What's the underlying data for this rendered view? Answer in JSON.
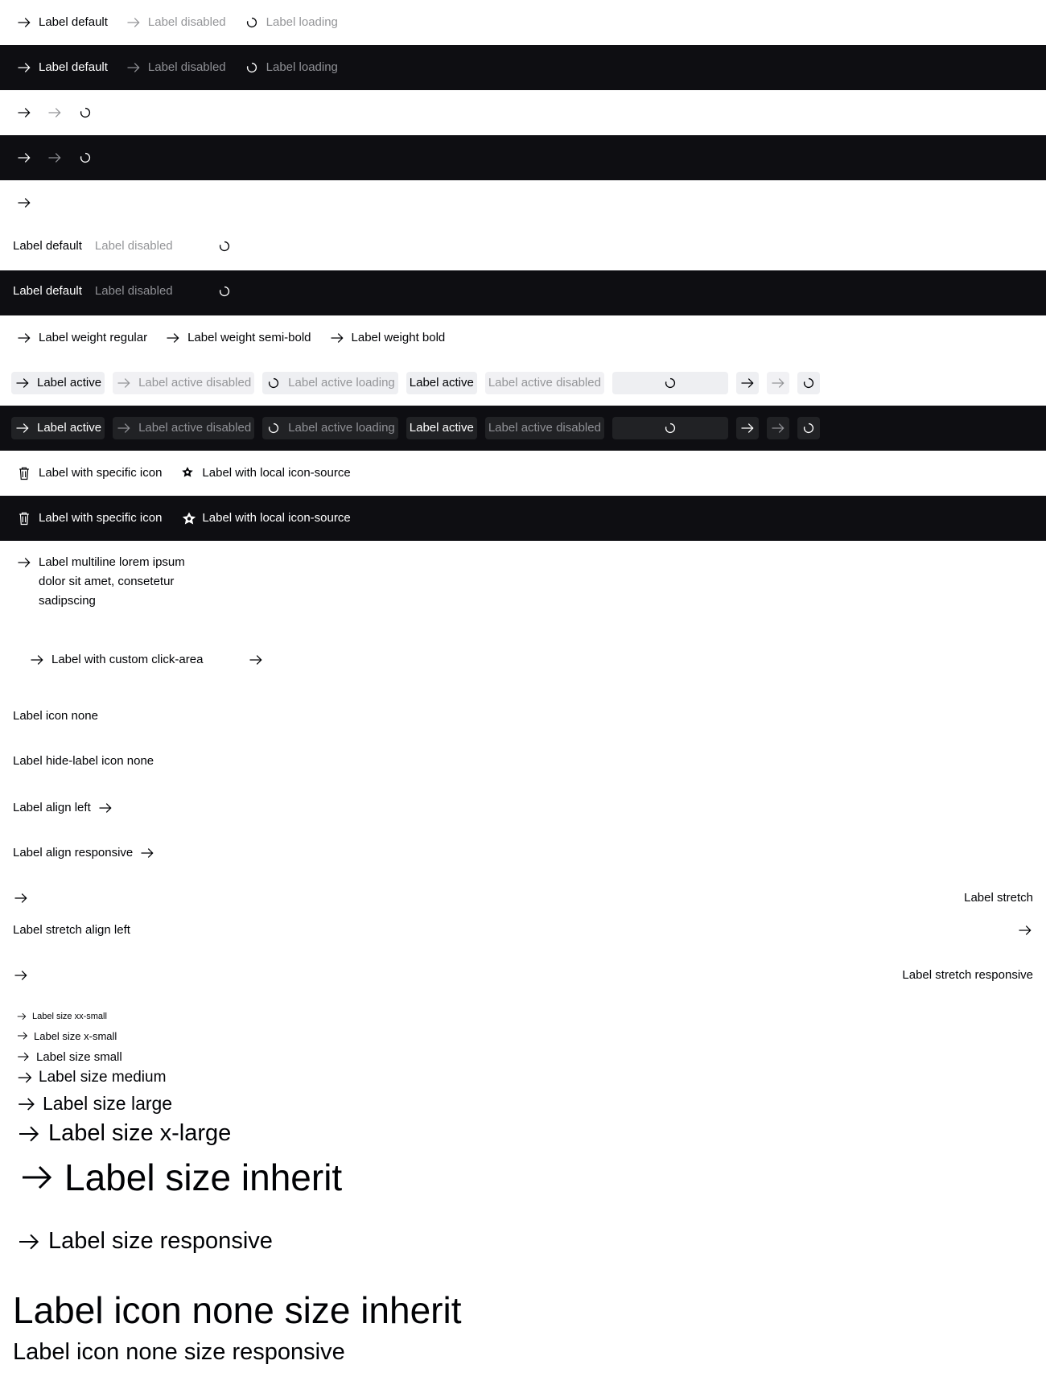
{
  "colors": {
    "dark_band": "#0e0e12",
    "text": "#010205",
    "disabled": "#949598",
    "active_bg": "#eeeff2"
  },
  "icons": {
    "arrow": "arrow-right-icon",
    "loader": "spinner-icon",
    "trash": "delete-icon",
    "local": "star-badge-icon"
  },
  "states": {
    "default": "Label default",
    "disabled": "Label disabled",
    "loading": "Label loading"
  },
  "weights": {
    "regular": "Label weight regular",
    "semibold": "Label weight semi-bold",
    "bold": "Label weight bold"
  },
  "active": {
    "active": "Label active",
    "active_disabled": "Label active disabled",
    "active_loading": "Label active loading"
  },
  "icons_labels": {
    "specific": "Label with specific icon",
    "local": "Label with local icon-source"
  },
  "multiline": {
    "line1": "Label multiline lorem ipsum",
    "line2": "dolor sit amet, consetetur",
    "line3": "sadipscing"
  },
  "custom_click": "Label with custom click-area",
  "icon_none": "Label icon none",
  "hide_label_icon_none": "Label hide-label icon none",
  "align_left": "Label align left",
  "align_responsive": "Label align responsive",
  "stretch": "Label stretch",
  "stretch_align_left": "Label stretch align left",
  "stretch_responsive": "Label stretch responsive",
  "sizes": {
    "xxsmall": "Label size xx-small",
    "xsmall": "Label size x-small",
    "small": "Label size small",
    "medium": "Label size medium",
    "large": "Label size large",
    "xlarge": "Label size x-large",
    "inherit": "Label size inherit",
    "responsive": "Label size responsive"
  },
  "icon_none_inherit": "Label icon none size inherit",
  "icon_none_responsive": "Label icon none size responsive"
}
